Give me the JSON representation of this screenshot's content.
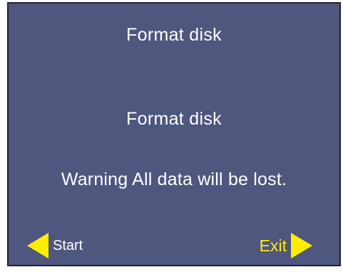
{
  "screen": {
    "title": "Format disk",
    "subtitle": "Format disk",
    "warning": "Warning All data will be lost."
  },
  "footer": {
    "start": {
      "label": "Start",
      "icon": "arrow-left-icon"
    },
    "exit": {
      "label": "Exit",
      "icon": "arrow-right-icon"
    }
  },
  "colors": {
    "background": "#4f577e",
    "text": "#ffffff",
    "accent": "#ffee00"
  }
}
